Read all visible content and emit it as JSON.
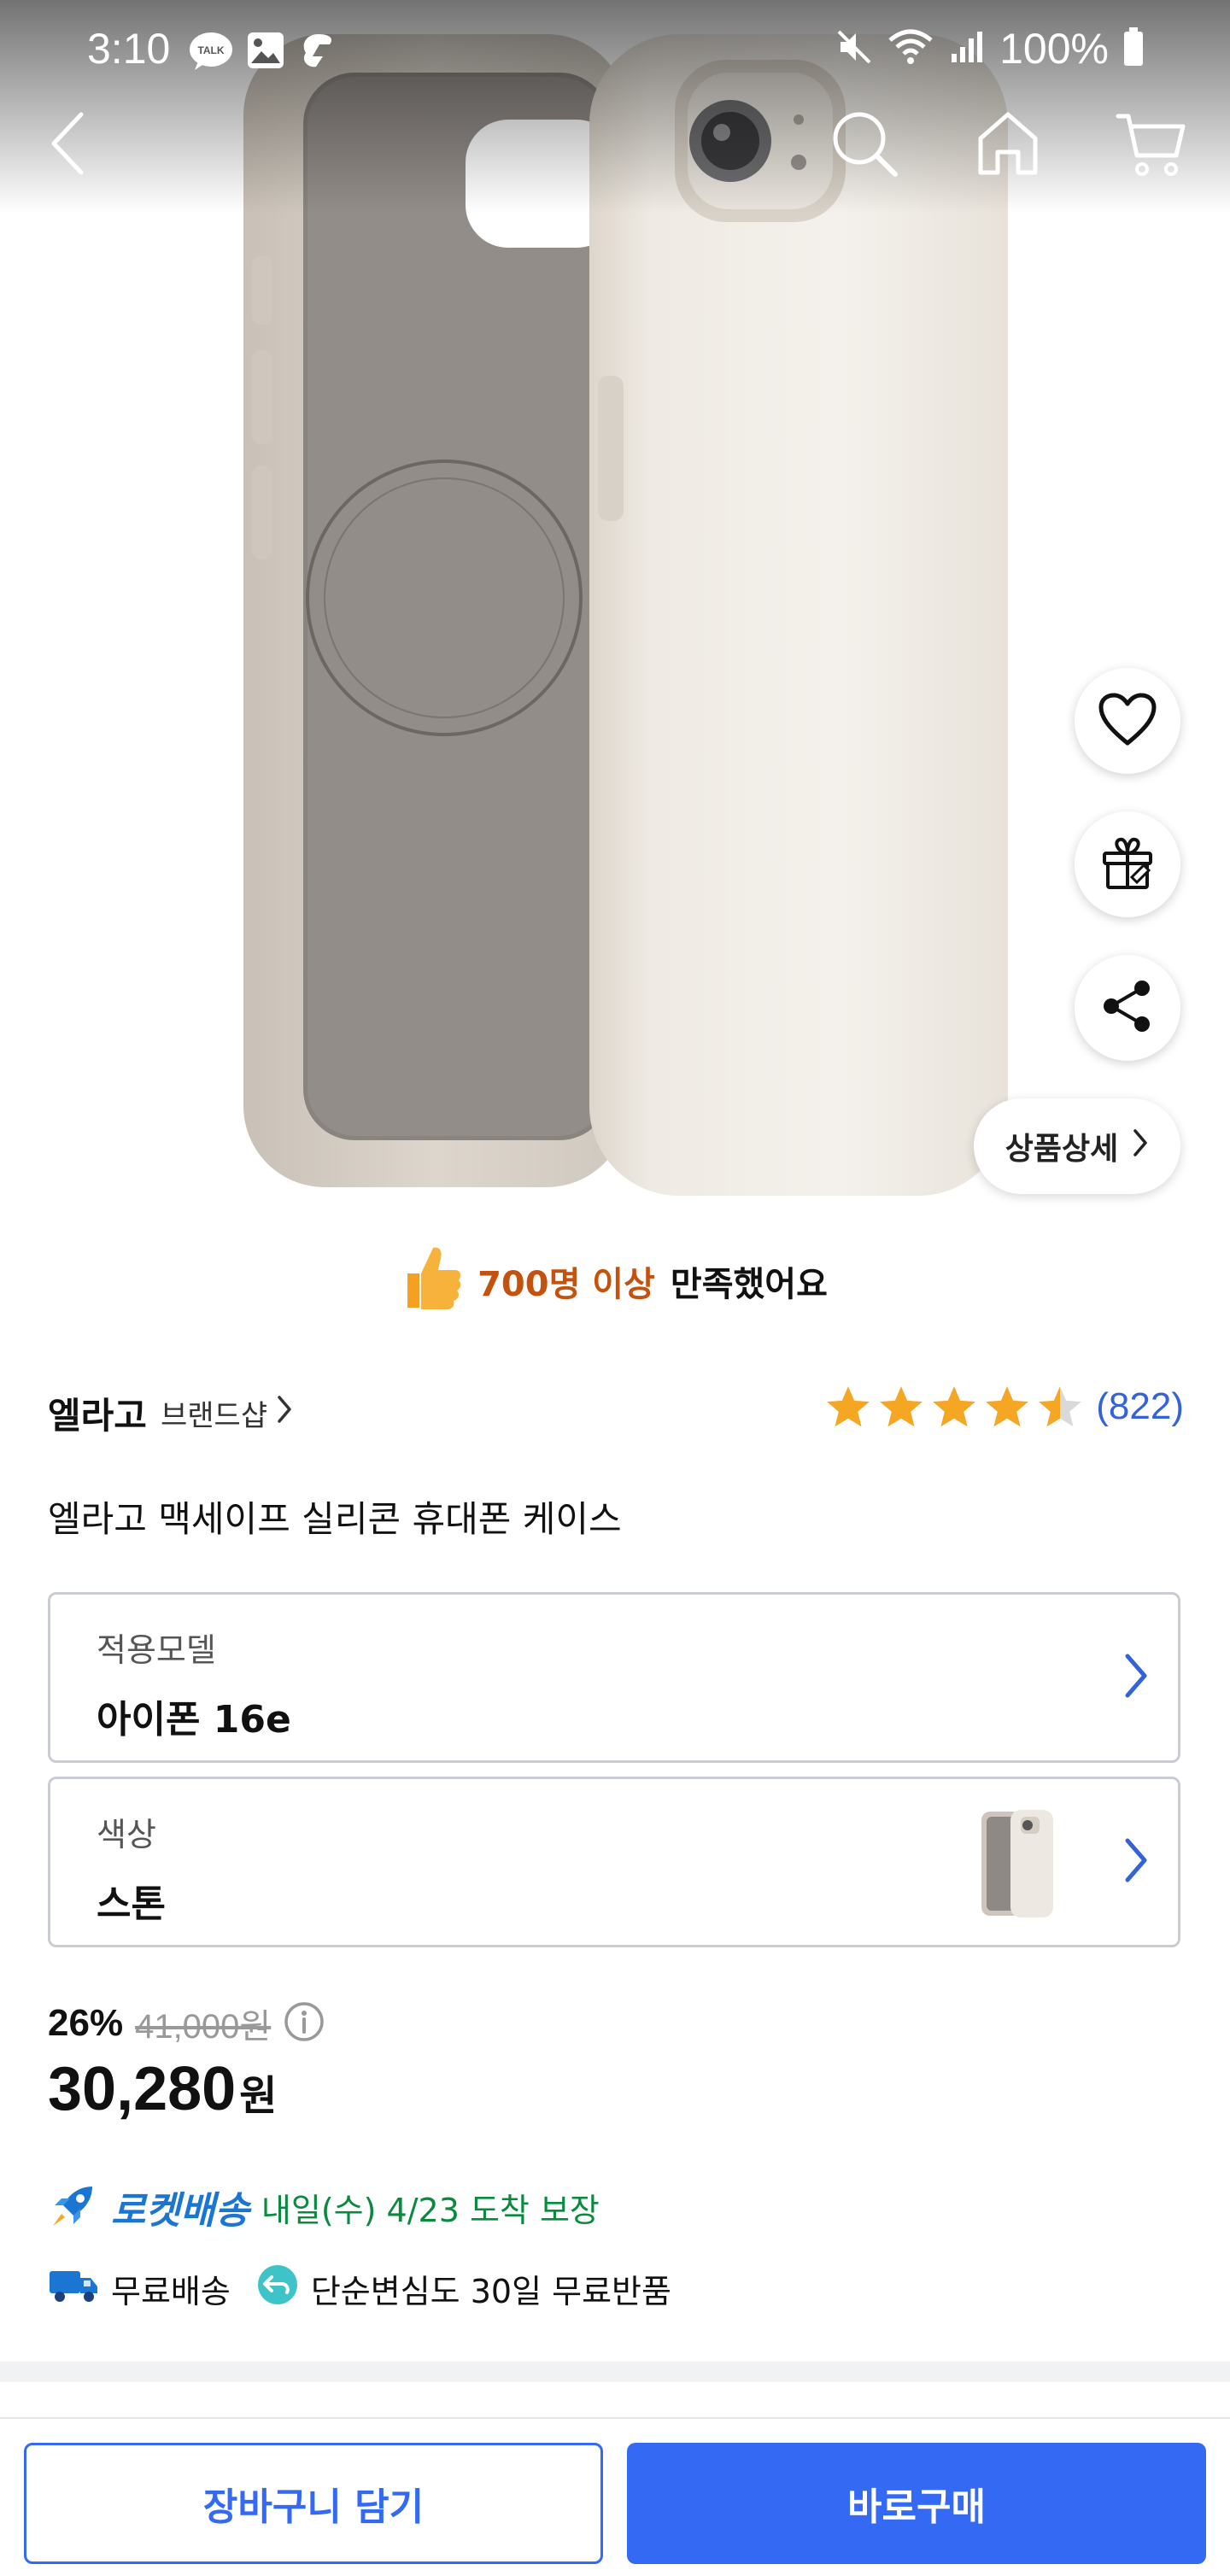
{
  "status_bar": {
    "time": "3:10",
    "battery_text": "100%",
    "left_icons": [
      "kakaotalk-icon",
      "gallery-icon",
      "threads-icon"
    ],
    "right_icons": [
      "mute-icon",
      "wifi-icon",
      "signal-icon",
      "battery-icon"
    ]
  },
  "top_nav": {
    "back_icon": "back-arrow-icon",
    "search_icon": "search-icon",
    "home_icon": "home-icon",
    "cart_icon": "cart-icon"
  },
  "floating_actions": {
    "like_icon": "heart-icon",
    "gift_icon": "gift-icon",
    "share_icon": "share-icon",
    "detail_label": "상품상세"
  },
  "satisfaction": {
    "count_text": "700명 이상",
    "rest_text": "만족했어요"
  },
  "brand": {
    "name": "엘라고",
    "shop_label": "브랜드샵"
  },
  "rating": {
    "stars": 4.5,
    "count": "(822)"
  },
  "product": {
    "title": "엘라고 맥세이프 실리콘 휴대폰 케이스"
  },
  "options": [
    {
      "label": "적용모델",
      "value": "아이폰 16e"
    },
    {
      "label": "색상",
      "value": "스톤"
    }
  ],
  "price": {
    "discount": "26%",
    "original": "41,000원",
    "current": "30,280",
    "unit": "원"
  },
  "delivery": {
    "rocket_label": "로켓배송",
    "arrival": "내일(수) 4/23 도착 보장",
    "free_shipping": "무료배송",
    "free_return": "단순변심도 30일 무료반품"
  },
  "bottom_bar": {
    "cart_label": "장바구니 담기",
    "buy_label": "바로구매"
  },
  "colors": {
    "accent_blue": "#3369f3",
    "rating_blue": "#3462d8",
    "star_gold": "#f5a623",
    "satisfaction_orange": "#c4510d",
    "rocket_blue": "#1a76d2",
    "arrival_green": "#0a8a3e"
  }
}
